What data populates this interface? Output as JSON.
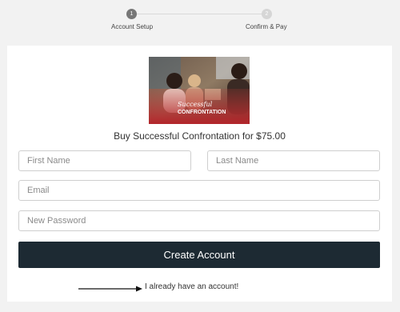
{
  "stepper": {
    "steps": [
      {
        "number": "1",
        "label": "Account Setup"
      },
      {
        "number": "2",
        "label": "Confirm & Pay"
      }
    ]
  },
  "product": {
    "image_caption": "Successful Confrontation",
    "title": "Buy Successful Confrontation for $75.00"
  },
  "form": {
    "first_name_placeholder": "First Name",
    "last_name_placeholder": "Last Name",
    "email_placeholder": "Email",
    "password_placeholder": "New Password",
    "create_button_label": "Create Account",
    "login_link_label": "I already have an account!"
  },
  "colors": {
    "button_bg": "#1d2a33",
    "page_bg": "#f2f2f2",
    "step_active": "#777777",
    "step_inactive": "#d6d6d6"
  }
}
